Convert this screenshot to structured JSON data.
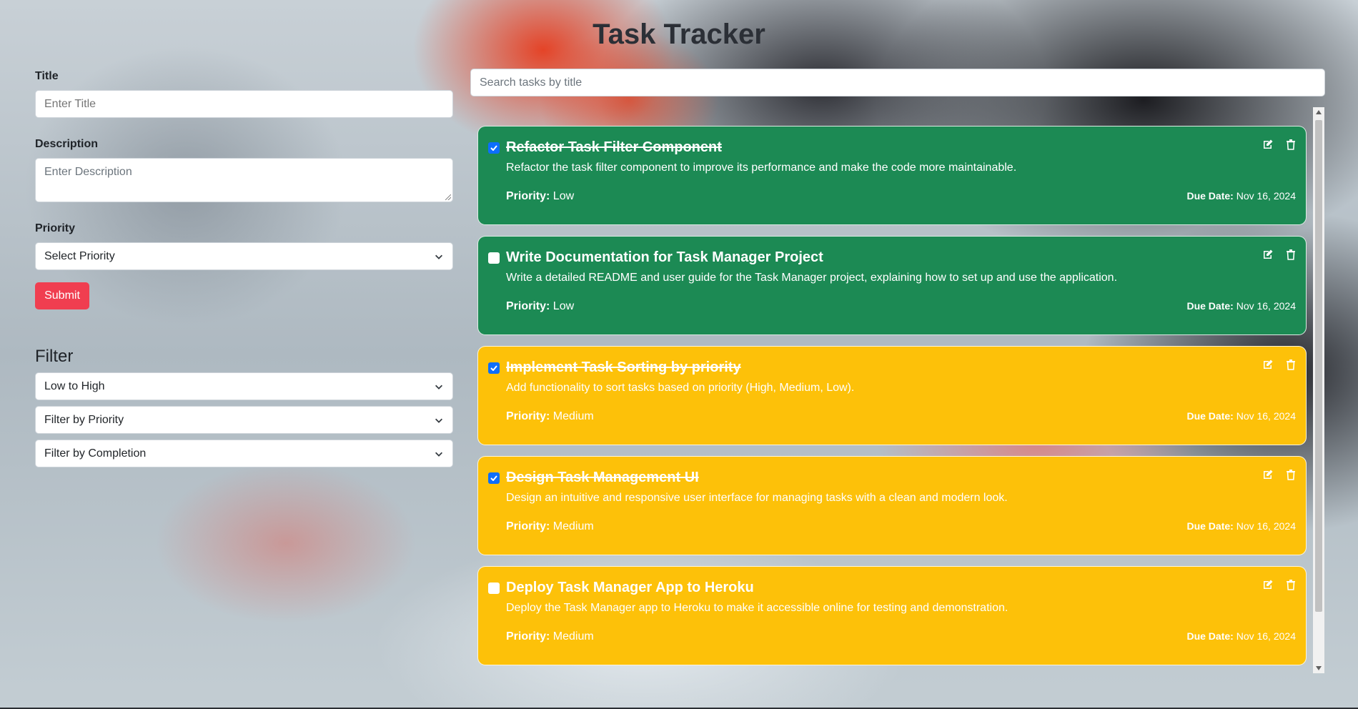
{
  "app": {
    "title": "Task Tracker"
  },
  "form": {
    "title_label": "Title",
    "title_placeholder": "Enter Title",
    "description_label": "Description",
    "description_placeholder": "Enter Description",
    "priority_label": "Priority",
    "priority_value": "Select Priority",
    "submit_label": "Submit"
  },
  "filter": {
    "heading": "Filter",
    "sort_value": "Low to High",
    "priority_value": "Filter by Priority",
    "completion_value": "Filter by Completion"
  },
  "search": {
    "placeholder": "Search tasks by title"
  },
  "colors": {
    "green": "#1c8a54",
    "yellow": "#fdc109",
    "submit": "#f03e50",
    "checkbox": "#0d6efd"
  },
  "tasks": [
    {
      "title": "Refactor Task Filter Component",
      "description": "Refactor the task filter component to improve its performance and make the code more maintainable.",
      "priority_label": "Priority:",
      "priority": "Low",
      "due_label": "Due Date:",
      "due": "Nov 16, 2024",
      "completed": true,
      "color": "green"
    },
    {
      "title": "Write Documentation for Task Manager Project",
      "description": "Write a detailed README and user guide for the Task Manager project, explaining how to set up and use the application.",
      "priority_label": "Priority:",
      "priority": "Low",
      "due_label": "Due Date:",
      "due": "Nov 16, 2024",
      "completed": false,
      "color": "green"
    },
    {
      "title": "Implement Task Sorting by priority",
      "description": "Add functionality to sort tasks based on priority (High, Medium, Low).",
      "priority_label": "Priority:",
      "priority": "Medium",
      "due_label": "Due Date:",
      "due": "Nov 16, 2024",
      "completed": true,
      "color": "yellow"
    },
    {
      "title": "Design Task Management UI",
      "description": "Design an intuitive and responsive user interface for managing tasks with a clean and modern look.",
      "priority_label": "Priority:",
      "priority": "Medium",
      "due_label": "Due Date:",
      "due": "Nov 16, 2024",
      "completed": true,
      "color": "yellow"
    },
    {
      "title": "Deploy Task Manager App to Heroku",
      "description": "Deploy the Task Manager app to Heroku to make it accessible online for testing and demonstration.",
      "priority_label": "Priority:",
      "priority": "Medium",
      "due_label": "Due Date:",
      "due": "Nov 16, 2024",
      "completed": false,
      "color": "yellow"
    }
  ]
}
